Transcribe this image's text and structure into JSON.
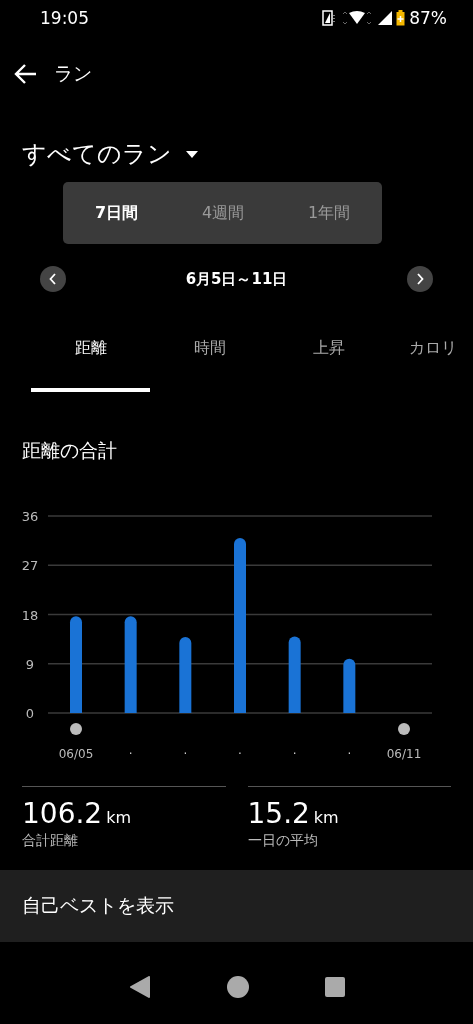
{
  "status_bar": {
    "time": "19:05",
    "battery": "87%"
  },
  "header": {
    "title": "ラン"
  },
  "filter": {
    "label": "すべてのラン"
  },
  "periods": [
    {
      "label": "7日間",
      "selected": true
    },
    {
      "label": "4週間",
      "selected": false
    },
    {
      "label": "1年間",
      "selected": false
    }
  ],
  "date_range": "6月5日～11日",
  "tabs": [
    {
      "label": "距離",
      "selected": true
    },
    {
      "label": "時間",
      "selected": false
    },
    {
      "label": "上昇",
      "selected": false
    },
    {
      "label": "カロリ",
      "selected": false
    }
  ],
  "section_title": "距離の合計",
  "chart_data": {
    "type": "bar",
    "grid": true,
    "categories": [
      "06/05",
      "·",
      "·",
      "·",
      "·",
      "·",
      "06/11"
    ],
    "series": [
      {
        "color": "#1a73d6",
        "values": [
          17.7,
          17.7,
          13.9,
          32,
          14,
          9.9,
          0
        ]
      }
    ],
    "ylim": [
      0,
      36
    ],
    "yticks": [
      0,
      9,
      18,
      27,
      36
    ]
  },
  "stats": [
    {
      "value": "106.2",
      "unit": "km",
      "label": "合計距離"
    },
    {
      "value": "15.2",
      "unit": "km",
      "label": "一日の平均"
    }
  ],
  "best_button": "自己ベストを表示"
}
